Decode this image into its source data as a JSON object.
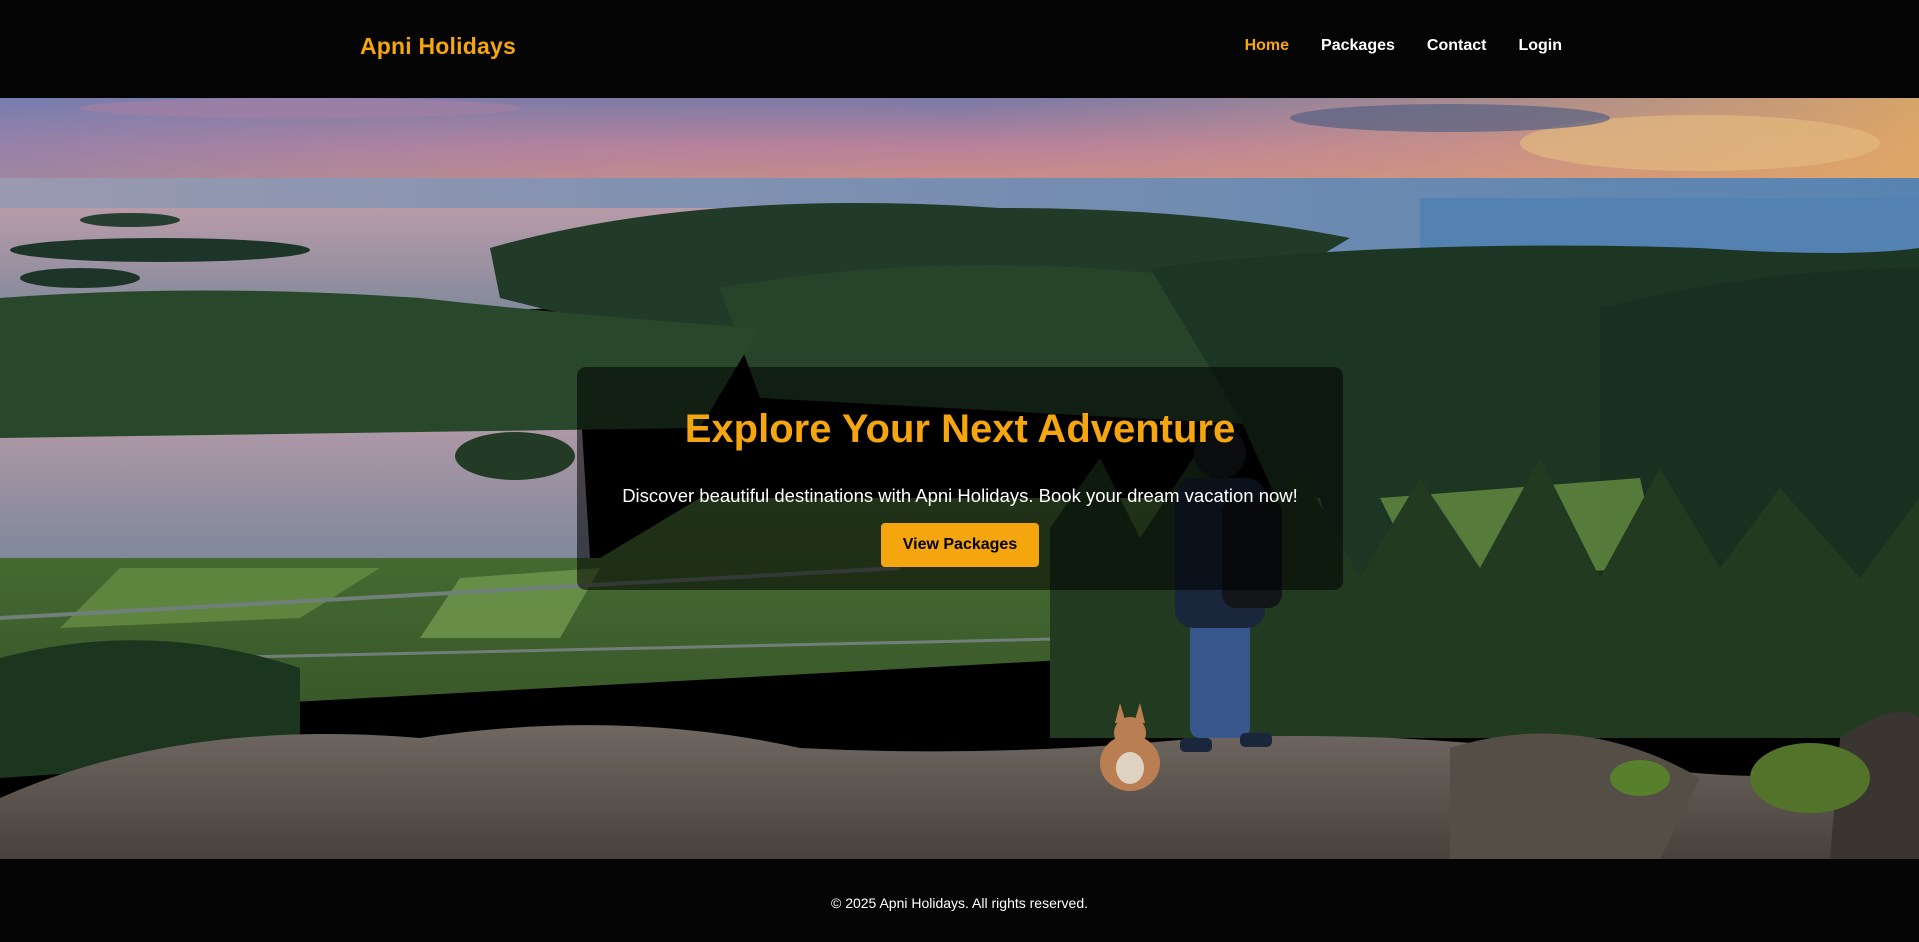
{
  "brand": {
    "name": "Apni Holidays",
    "accent_color": "#f5a60e"
  },
  "nav": {
    "items": [
      {
        "label": "Home",
        "active": true
      },
      {
        "label": "Packages",
        "active": false
      },
      {
        "label": "Contact",
        "active": false
      },
      {
        "label": "Login",
        "active": false
      }
    ]
  },
  "hero": {
    "background_image": "mountain-overlook-landscape",
    "title": "Explore Your Next Adventure",
    "subtitle": "Discover beautiful destinations with Apni Holidays. Book your dream vacation now!",
    "button_label": "View Packages"
  },
  "footer": {
    "text": "© 2025 Apni Holidays. All rights reserved."
  }
}
